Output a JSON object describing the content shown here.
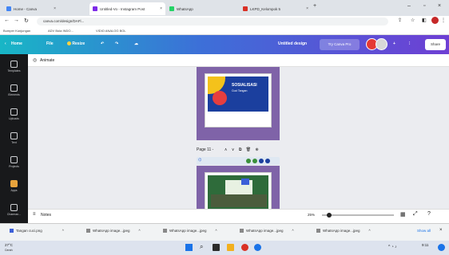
{
  "browser": {
    "tabs": [
      {
        "label": "Home - Canva",
        "color": "#4285f4"
      },
      {
        "label": "Untitled-Vo - Instagram Post",
        "color": "#7d2ae8"
      },
      {
        "label": "WhatsApp",
        "color": "#25d366"
      },
      {
        "label": "LKPD_Kelompok 5",
        "color": "#d93025"
      }
    ],
    "url": "canva.com/design/DAFl...",
    "bookmarks": [
      "Bumper Kunjungan",
      "ADV Bola INDO...",
      "VIDIO ANALOG BOL"
    ]
  },
  "toolbar": {
    "home": "Home",
    "file": "File",
    "resize": "Resize",
    "project": "Untitled design",
    "try_pro": "Try Canva Pro",
    "share": "Share",
    "plus": "+"
  },
  "sidebar": {
    "items": [
      {
        "label": "Templates"
      },
      {
        "label": "Elements"
      },
      {
        "label": "Uploads"
      },
      {
        "label": "Text"
      },
      {
        "label": "Projects"
      },
      {
        "label": "Apps"
      },
      {
        "label": "Charman..."
      }
    ]
  },
  "canvas": {
    "animate": "Animate",
    "page_label": "Page 11 - ",
    "slide_title": "SOSIALISASI",
    "slide_sub": "Cuci Tangan"
  },
  "bottom": {
    "notes": "Notes",
    "zoom": "25%"
  },
  "downloads": [
    {
      "name": "Tangan cuci.png"
    },
    {
      "name": "WhatsApp image...jpeg"
    },
    {
      "name": "WhatsApp image...jpeg"
    },
    {
      "name": "WhatsApp image...jpeg"
    },
    {
      "name": "WhatsApp image...jpeg"
    }
  ],
  "downloads_show_all": "Show all",
  "taskbar": {
    "weather": "27°C",
    "weather_sub": "Cerah",
    "time": "9:11",
    "date": "..."
  },
  "colors": {
    "page": "#7f63a8",
    "sidebar": "#18191b",
    "accent": "#3d6fd8"
  }
}
